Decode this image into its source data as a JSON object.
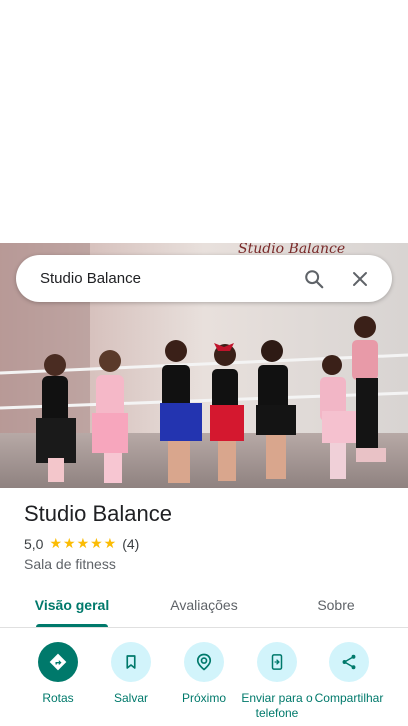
{
  "search": {
    "query": "Studio Balance"
  },
  "photo": {
    "wall_text_partial": "Studio Balance"
  },
  "place": {
    "name": "Studio Balance",
    "rating": "5,0",
    "stars": "★★★★★",
    "review_count": "(4)",
    "category": "Sala de fitness"
  },
  "tabs": [
    {
      "label": "Visão geral",
      "active": true
    },
    {
      "label": "Avaliações",
      "active": false
    },
    {
      "label": "Sobre",
      "active": false
    }
  ],
  "actions": [
    {
      "label": "Rotas",
      "icon": "directions-icon"
    },
    {
      "label": "Salvar",
      "icon": "bookmark-icon"
    },
    {
      "label": "Próximo",
      "icon": "nearby-icon"
    },
    {
      "label": "Enviar para o telefone",
      "icon": "send-to-phone-icon"
    },
    {
      "label": "Compartilhar",
      "icon": "share-icon"
    }
  ],
  "colors": {
    "accent": "#00796b",
    "action_bg": "#d2f4fb",
    "star": "#fbbc04"
  }
}
